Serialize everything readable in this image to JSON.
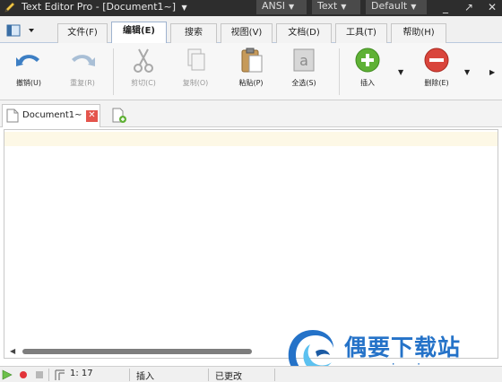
{
  "window": {
    "app_name": "Text Editor Pro",
    "separator": "-",
    "document_title": "[Document1~]",
    "encoding_dropdown": "ANSI",
    "syntax_dropdown": "Text",
    "theme_dropdown": "Default",
    "minimize_glyph": "_",
    "restore_glyph": "↗",
    "close_glyph": "✕"
  },
  "menu_tabs": [
    {
      "label": "文件(F)",
      "active": false
    },
    {
      "label": "编辑(E)",
      "active": true
    },
    {
      "label": "搜索",
      "active": false
    },
    {
      "label": "视图(V)",
      "active": false
    },
    {
      "label": "文档(D)",
      "active": false
    },
    {
      "label": "工具(T)",
      "active": false
    },
    {
      "label": "帮助(H)",
      "active": false
    }
  ],
  "ribbon": {
    "undo": "撤销(U)",
    "redo": "重复(R)",
    "cut": "剪切(C)",
    "copy": "复制(O)",
    "paste": "粘贴(P)",
    "select_all": "全选(S)",
    "insert": "插入",
    "delete": "删除(E)"
  },
  "doc_tab": {
    "label": "Document1~",
    "close_glyph": "✕"
  },
  "status": {
    "position": "1: 17",
    "mode": "插入",
    "modified": "已更改"
  },
  "watermark": {
    "title": "偶要下载站",
    "url": "ouyaoxiazai.com"
  },
  "colors": {
    "title_bar": "#2d2d2d",
    "current_line": "#fdf8e6",
    "insert_green": "#5fb135",
    "delete_red": "#d9453c",
    "close_red": "#e4554d",
    "watermark_blue": "#2472c8"
  }
}
